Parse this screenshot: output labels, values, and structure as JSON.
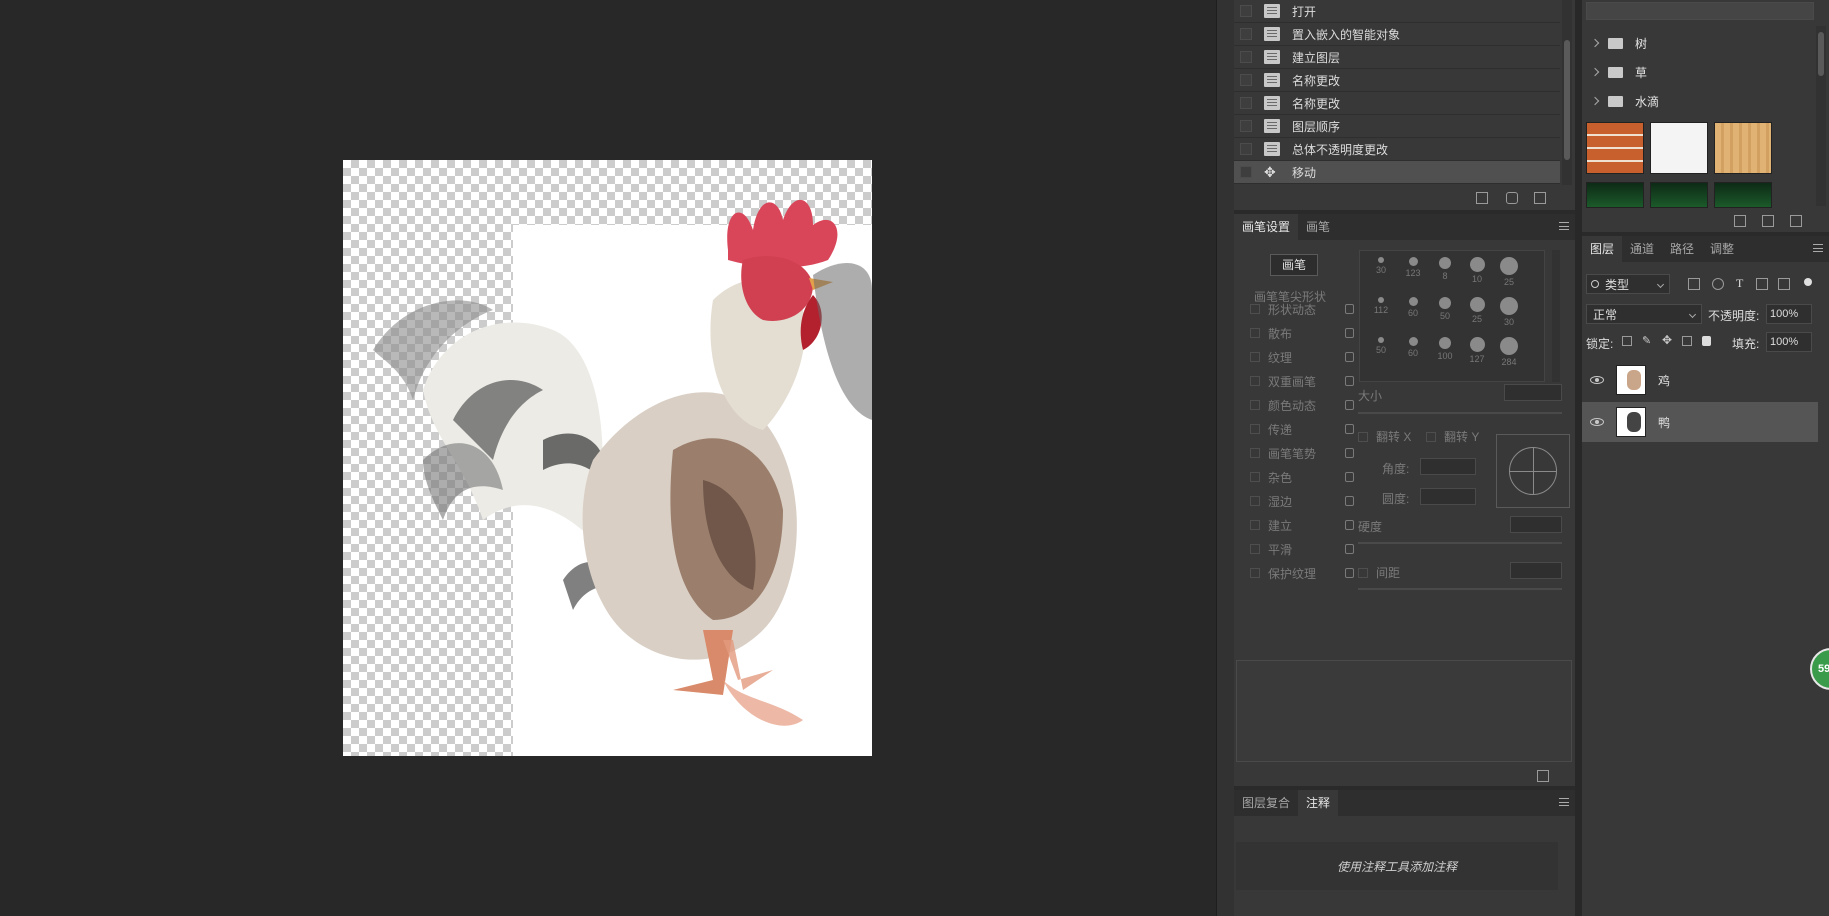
{
  "history": {
    "items": [
      {
        "label": "打开",
        "icon": "document-icon"
      },
      {
        "label": "置入嵌入的智能对象",
        "icon": "document-icon"
      },
      {
        "label": "建立图层",
        "icon": "document-icon"
      },
      {
        "label": "名称更改",
        "icon": "document-icon"
      },
      {
        "label": "名称更改",
        "icon": "document-icon"
      },
      {
        "label": "图层顺序",
        "icon": "document-icon"
      },
      {
        "label": "总体不透明度更改",
        "icon": "document-icon"
      },
      {
        "label": "移动",
        "icon": "move-icon"
      }
    ]
  },
  "brush_panel": {
    "tabs": [
      "画笔设置",
      "画笔"
    ],
    "preset_button": "画笔",
    "tip_shape": "画笔笔尖形状",
    "options": [
      "形状动态",
      "散布",
      "纹理",
      "双重画笔",
      "颜色动态",
      "传递",
      "画笔笔势",
      "杂色",
      "湿边",
      "建立",
      "平滑",
      "保护纹理"
    ],
    "preset_sizes": [
      "30",
      "123",
      "8",
      "10",
      "25",
      "112",
      "60",
      "50",
      "25",
      "30",
      "50",
      "60",
      "100",
      "127",
      "284"
    ],
    "size_label": "大小",
    "flip_x": "翻转 X",
    "flip_y": "翻转 Y",
    "angle_label": "角度:",
    "roundness_label": "圆度:",
    "hardness_label": "硬度",
    "spacing_label": "间距"
  },
  "notes_panel": {
    "tabs": [
      "图层复合",
      "注释"
    ],
    "placeholder": "使用注释工具添加注释"
  },
  "libraries": {
    "folders": [
      "树",
      "草",
      "水滴"
    ]
  },
  "layers_panel": {
    "tabs": [
      "图层",
      "通道",
      "路径",
      "调整"
    ],
    "filter_label": "类型",
    "blend_mode": "正常",
    "opacity_label": "不透明度:",
    "opacity_value": "100%",
    "lock_label": "锁定:",
    "fill_label": "填充:",
    "fill_value": "100%",
    "layers": [
      {
        "name": "鸡",
        "selected": false
      },
      {
        "name": "鸭",
        "selected": true
      }
    ]
  },
  "badge": {
    "text": "59"
  },
  "colors": {
    "accent_green": "#3a9c4a",
    "panel_bg": "#383838",
    "canvas_bg": "#282828"
  }
}
